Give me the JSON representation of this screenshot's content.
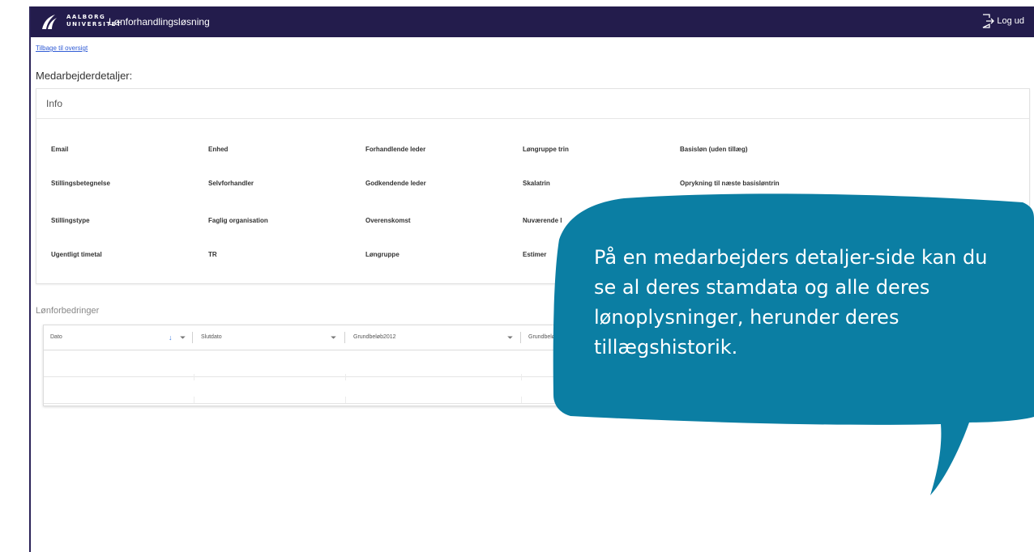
{
  "header": {
    "brand_line1": "AALBORG",
    "brand_line2": "UNIVERSITET",
    "app_title": "Lønforhandlingsløsning",
    "logout_label": "Log ud",
    "logo_icon": "aau-waves-logo",
    "logout_icon": "logout-icon",
    "bg_color": "#231c4c"
  },
  "back_link": "Tilbage til oversigt",
  "page_title": "Medarbejderdetaljer:",
  "info": {
    "title": "Info",
    "rows": [
      [
        "Email",
        "Enhed",
        "Forhandlende leder",
        "Løngruppe trin",
        "Basisløn (uden tillæg)"
      ],
      [
        "Stillingsbetegnelse",
        "Selvforhandler",
        "Godkendende leder",
        "Skalatrin",
        "Oprykning til næste basisløntrin"
      ],
      [
        "Stillingstype",
        "Faglig organisation",
        "Overenskomst",
        "Nuværende l"
      ],
      [
        "Ugentligt timetal",
        "TR",
        "Løngruppe",
        "Estimer"
      ]
    ]
  },
  "salary": {
    "title": "Lønforbedringer",
    "columns": [
      "Dato",
      "Slutdato",
      "Grundbeløb2012",
      "Grundbeløb"
    ],
    "sort_icon": "arrow-down-icon",
    "filter_icon": "filter-icon",
    "info_icon": "info-circle-icon"
  },
  "callout": {
    "text": "På en medarbejders detaljer-side kan du se al deres stamdata og alle deres lønoplysninger, herunder deres tillægshistorik.",
    "color": "#0b7ea3"
  }
}
